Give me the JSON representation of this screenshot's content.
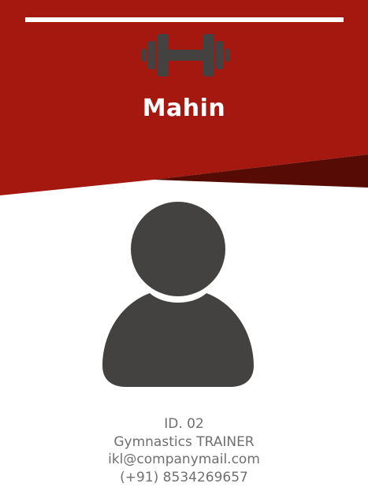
{
  "colors": {
    "header_red": "#a5180f",
    "header_dark": "#560c05",
    "icon_dark": "#434240",
    "text_gray": "#6f6f6f"
  },
  "header": {
    "icon": "dumbbell-icon",
    "name": "Mahin"
  },
  "photo": {
    "icon": "user-avatar-icon"
  },
  "info": {
    "id": "ID. 02",
    "role": "Gymnastics TRAINER",
    "email": "ikl@companymail.com",
    "phone": "(+91) 8534269657"
  }
}
